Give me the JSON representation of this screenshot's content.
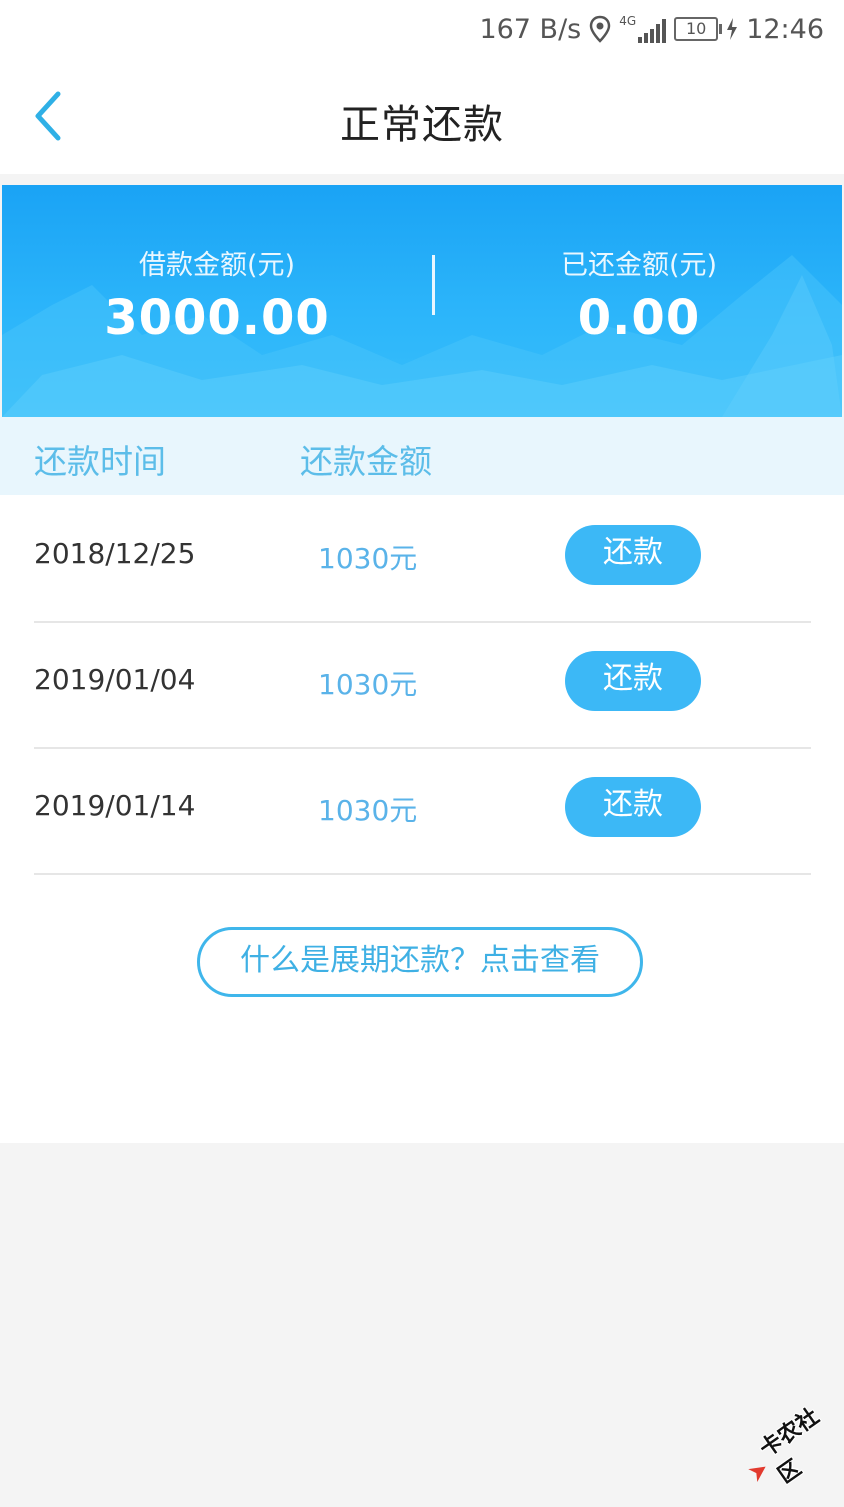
{
  "status_bar": {
    "speed": "167 B/s",
    "network": "4G",
    "battery": "10",
    "time": "12:46"
  },
  "header": {
    "title": "正常还款"
  },
  "summary": {
    "loan_label": "借款金额(元)",
    "loan_value": "3000.00",
    "repaid_label": "已还金额(元)",
    "repaid_value": "0.00"
  },
  "table": {
    "col_time": "还款时间",
    "col_amount": "还款金额",
    "rows": [
      {
        "date": "2018/12/25",
        "amount": "1030元",
        "action": "还款"
      },
      {
        "date": "2019/01/04",
        "amount": "1030元",
        "action": "还款"
      },
      {
        "date": "2019/01/14",
        "amount": "1030元",
        "action": "还款"
      }
    ]
  },
  "extension_link": "什么是展期还款？点击查看",
  "watermark": "卡农社区",
  "colors": {
    "accent": "#3cb8f6",
    "hero_top": "#1aa3f5",
    "header_row": "#e8f6fd",
    "amount_text": "#5ab3e9"
  }
}
